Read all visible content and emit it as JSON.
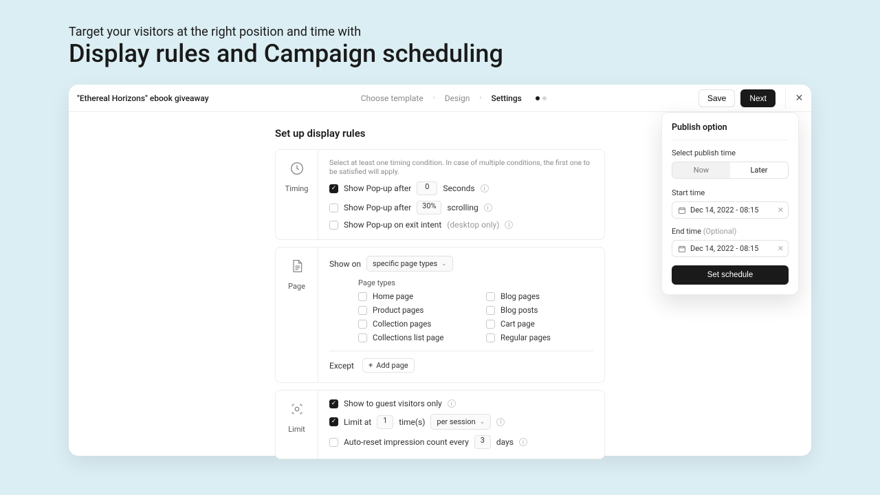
{
  "hero": {
    "sub": "Target your visitors at the right position and time with",
    "title": "Display rules and Campaign scheduling"
  },
  "topbar": {
    "campaign": "\"Ethereal Horizons\" ebook giveaway",
    "steps": {
      "choose": "Choose template",
      "design": "Design",
      "settings": "Settings"
    },
    "save": "Save",
    "next": "Next"
  },
  "section_title": "Set up display rules",
  "timing": {
    "side_label": "Timing",
    "hint": "Select at least one timing condition. In case of multiple conditions, the first one to be satisfied will apply.",
    "after_label": "Show Pop-up after",
    "after_value": "0",
    "after_unit": "Seconds",
    "scroll_label": "Show Pop-up after",
    "scroll_value": "30%",
    "scroll_unit": "scrolling",
    "exit_label": "Show Pop-up on exit intent",
    "exit_note": "(desktop only)"
  },
  "page": {
    "side_label": "Page",
    "show_on_label": "Show on",
    "show_on_value": "specific page types",
    "types_heading": "Page types",
    "types": {
      "home": "Home page",
      "product": "Product pages",
      "collection": "Collection pages",
      "collections_list": "Collections list page",
      "blog_pages": "Blog pages",
      "blog_posts": "Blog posts",
      "cart": "Cart page",
      "regular": "Regular pages"
    },
    "except_label": "Except",
    "add_page": "Add page"
  },
  "limit": {
    "side_label": "Limit",
    "guest_label": "Show to guest visitors only",
    "limit_at_label": "Limit at",
    "limit_value": "1",
    "limit_unit": "time(s)",
    "per_value": "per session",
    "reset_label": "Auto-reset impression count every",
    "reset_value": "3",
    "reset_unit": "days"
  },
  "publish": {
    "title": "Publish option",
    "select_label": "Select publish time",
    "now": "Now",
    "later": "Later",
    "start_label": "Start time",
    "start_value": "Dec 14, 2022 - 08:15",
    "end_label": "End time",
    "end_optional": "(Optional)",
    "end_value": "Dec 14, 2022 - 08:15",
    "set_btn": "Set schedule"
  }
}
